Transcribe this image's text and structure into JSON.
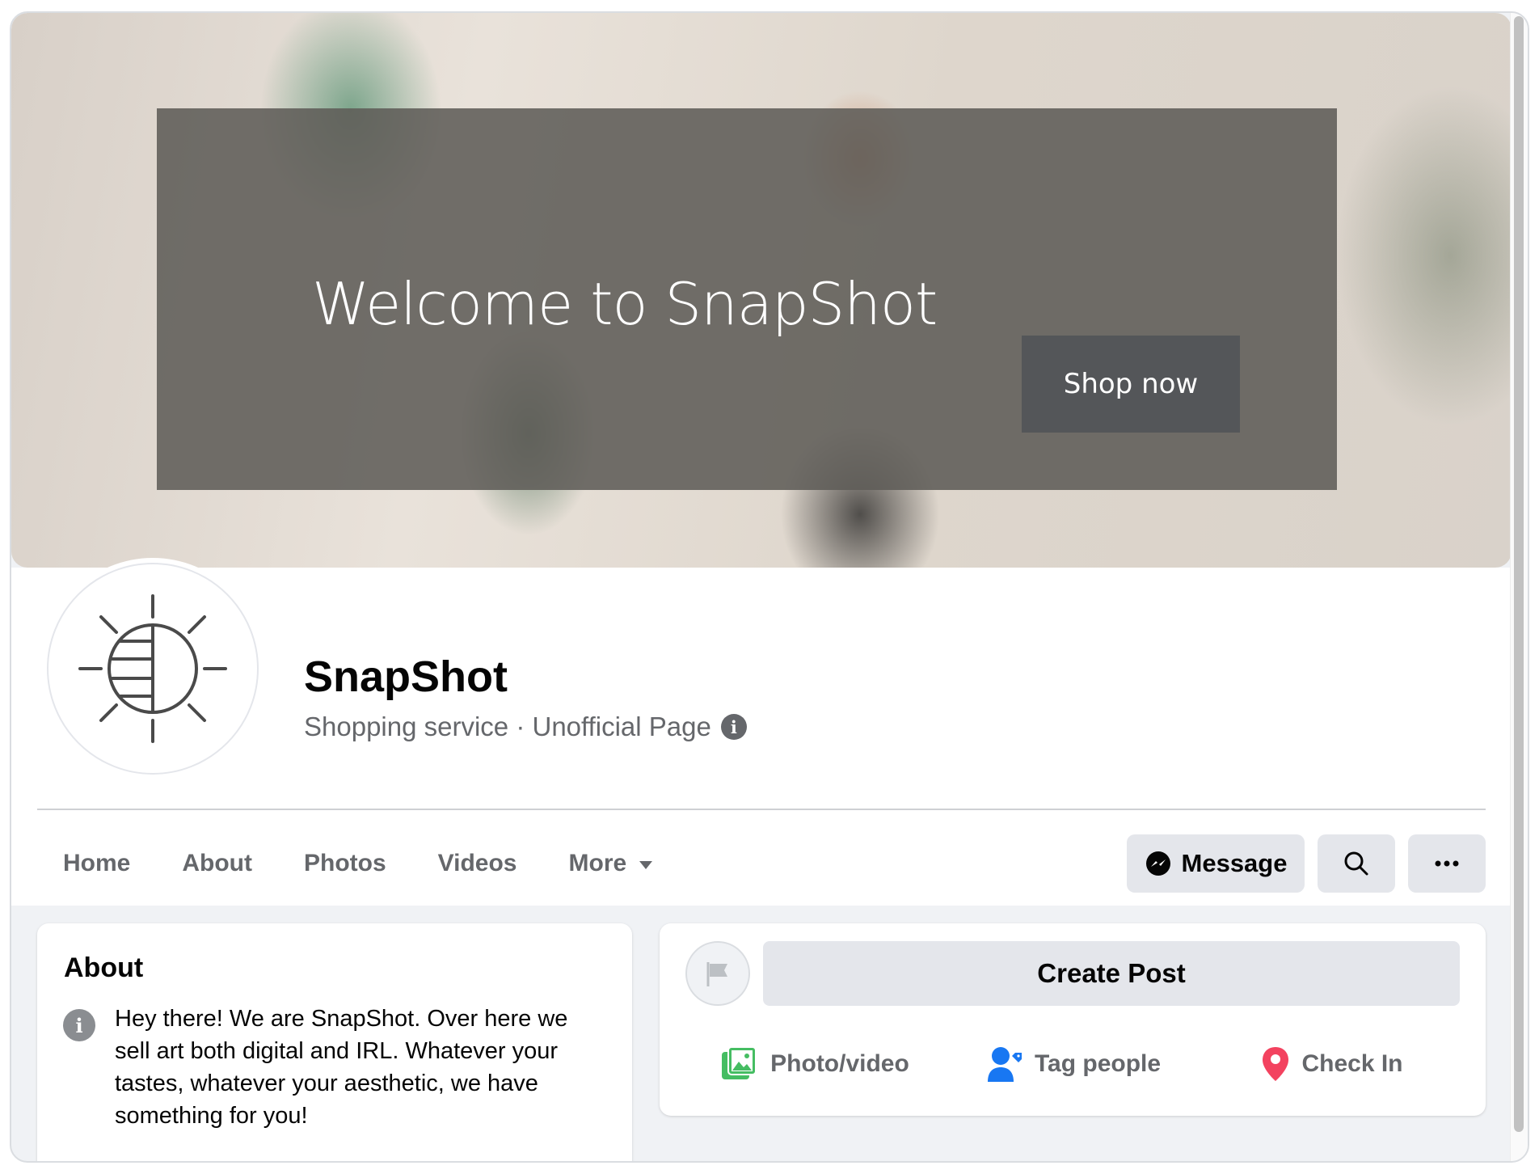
{
  "cover": {
    "banner_title": "Welcome to SnapShot",
    "shop_button": "Shop now"
  },
  "page": {
    "name": "SnapShot",
    "category": "Shopping service · Unofficial Page"
  },
  "tabs": [
    {
      "label": "Home"
    },
    {
      "label": "About"
    },
    {
      "label": "Photos"
    },
    {
      "label": "Videos"
    },
    {
      "label": "More"
    }
  ],
  "actions": {
    "message_label": "Message"
  },
  "about": {
    "title": "About",
    "text": "Hey there! We are SnapShot. Over here we sell art both digital and IRL. Whatever your tastes, whatever your aesthetic, we have something for you!"
  },
  "composer": {
    "create_post": "Create Post",
    "photo_video": "Photo/video",
    "tag_people": "Tag people",
    "check_in": "Check In"
  },
  "colors": {
    "messenger": "#050505",
    "photo_green": "#45bd62",
    "tag_blue": "#1877f2",
    "checkin_red": "#f3425f"
  }
}
